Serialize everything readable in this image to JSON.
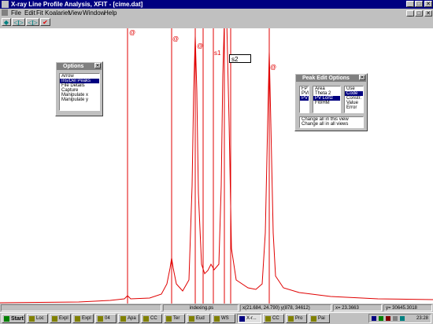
{
  "window": {
    "title": "X-ray Line Profile Analysis, XFIT - [cime.dat]"
  },
  "menu": [
    "File",
    "Edit",
    "Fit",
    "Koalariet",
    "View",
    "Window",
    "Help"
  ],
  "toolbar": {
    "btn1": "◆",
    "btn2": "◁▷",
    "btn3": "◁▷",
    "btn4": "✔"
  },
  "plot": {
    "markers": {
      "m1": "@",
      "m2": "@",
      "m3": "@",
      "s1": "s1",
      "m5": "@"
    },
    "s2_value": "s2",
    "line_color": "#e00000",
    "profile_color": "#e00000"
  },
  "options_dialog": {
    "title": "Options",
    "items": [
      "Arrow",
      "Ins/Del Peaks",
      "File Details",
      "Capture",
      "Manipulate x",
      "Manipulate y"
    ],
    "selected": "Ins/Del Peaks"
  },
  "peak_dialog": {
    "title": "Peak Edit Options",
    "list1": [
      "FP",
      "PVI",
      "PV"
    ],
    "list1_selected": "PV",
    "list2": [
      "Area",
      "Theta 2",
      "PV Lortz",
      "FWHM"
    ],
    "list2_selected": "PV Lortz",
    "list3": [
      "Use",
      "Code",
      "Constr.",
      "Value",
      "Error"
    ],
    "list3_selected": "Code",
    "options": [
      "Change all in this view",
      "Change all in all views"
    ]
  },
  "status": {
    "file": "indexing.ps",
    "coords": "x(21.684, 24.790) y(878, 34612)",
    "x": "x= 23.3663",
    "y": "y= 30645.3018"
  },
  "taskbar": {
    "start": "Start",
    "tasks": [
      "Loc",
      "Expl",
      "Expl",
      "04",
      "Apa",
      "CC",
      "Ter",
      "Eud",
      "WS",
      "X-r...",
      "CC",
      "Pro",
      "Pai"
    ],
    "active_index": 9,
    "clock": "23:28"
  }
}
